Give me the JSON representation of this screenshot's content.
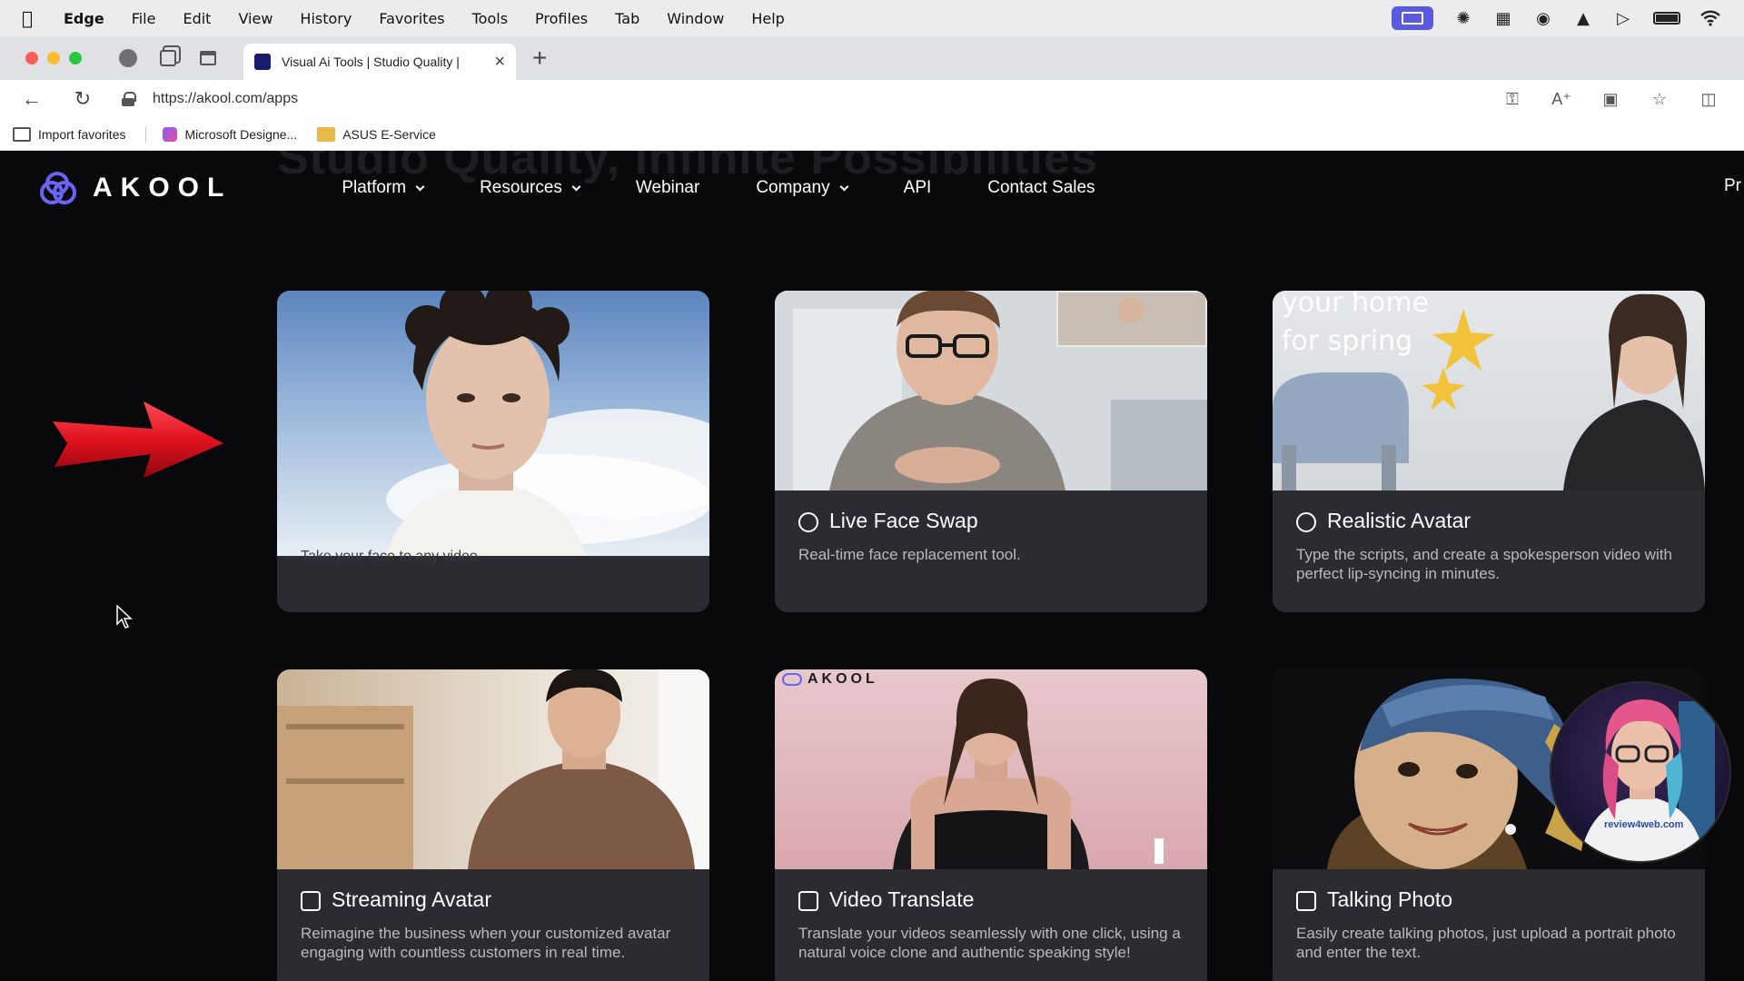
{
  "menubar": {
    "app_name": "Edge",
    "items": [
      "File",
      "Edit",
      "View",
      "History",
      "Favorites",
      "Tools",
      "Profiles",
      "Tab",
      "Window",
      "Help"
    ]
  },
  "tab": {
    "title": "Visual Ai Tools | Studio Quality |"
  },
  "address": {
    "url": "https://akool.com/apps"
  },
  "favorites": [
    {
      "label": "Import favorites",
      "icon": "import-icon"
    },
    {
      "label": "Microsoft Designe...",
      "icon": "designer-icon"
    },
    {
      "label": "ASUS E-Service",
      "icon": "folder-icon"
    }
  ],
  "site": {
    "ghost_heading": "Studio Quality, Infinite Possibilities",
    "logo_text": "AKOOL",
    "nav": [
      {
        "label": "Platform",
        "dropdown": true
      },
      {
        "label": "Resources",
        "dropdown": true
      },
      {
        "label": "Webinar",
        "dropdown": false
      },
      {
        "label": "Company",
        "dropdown": true
      },
      {
        "label": "API",
        "dropdown": false
      },
      {
        "label": "Contact Sales",
        "dropdown": false
      }
    ],
    "header_cut": "Pr"
  },
  "cards": [
    {
      "title": "",
      "desc": "Take your face to any video.",
      "icon": ""
    },
    {
      "title": "Live Face Swap",
      "desc": "Real-time face replacement tool.",
      "icon": "face-icon"
    },
    {
      "title": "Realistic Avatar",
      "desc": "Type the scripts, and create a spokesperson video with perfect lip-syncing in minutes.",
      "icon": "face-icon"
    },
    {
      "title": "Streaming Avatar",
      "desc": "Reimagine the business when your customized avatar engaging with countless customers in real time.",
      "icon": "image-icon"
    },
    {
      "title": "Video Translate",
      "desc": "Translate your videos seamlessly with one click,  using a natural voice clone and authentic speaking style!",
      "icon": "translate-icon"
    },
    {
      "title": "Talking Photo",
      "desc": "Easily create talking photos, just upload a portrait photo and enter the text.",
      "icon": "photo-icon"
    }
  ],
  "thumb_text": {
    "realistic_overlay_1": "your home",
    "realistic_overlay_2": "for spring",
    "translate_watermark": "AKOOL",
    "pip_shirt": "review4web.com"
  },
  "colors": {
    "page_bg": "#09090c",
    "card_bg": "#2b2b31",
    "brand": "#6b63f5",
    "arrow": "#e0121e"
  }
}
